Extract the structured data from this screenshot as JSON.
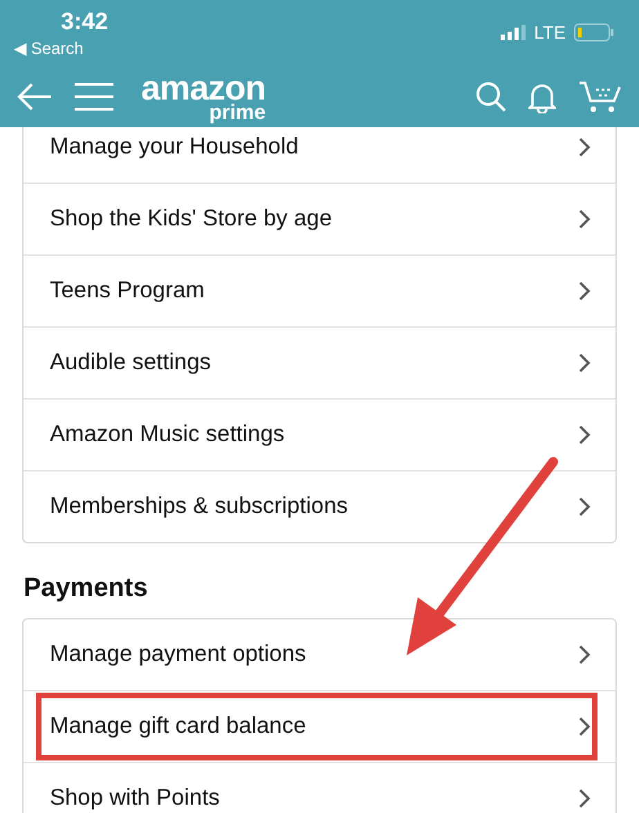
{
  "status_bar": {
    "time": "3:42",
    "back_label": "◀ Search",
    "network": "LTE"
  },
  "nav": {
    "logo_word": "amazon",
    "logo_sub": "prime"
  },
  "sections": [
    {
      "rows": [
        {
          "label": "Manage your Household",
          "highlighted": false
        },
        {
          "label": "Shop the Kids' Store by age",
          "highlighted": false
        },
        {
          "label": "Teens Program",
          "highlighted": false
        },
        {
          "label": "Audible settings",
          "highlighted": false
        },
        {
          "label": "Amazon Music settings",
          "highlighted": false
        },
        {
          "label": "Memberships & subscriptions",
          "highlighted": false
        }
      ]
    },
    {
      "heading": "Payments",
      "rows": [
        {
          "label": "Manage payment options",
          "highlighted": false
        },
        {
          "label": "Manage gift card balance",
          "highlighted": true
        },
        {
          "label": "Shop with Points",
          "highlighted": false
        }
      ]
    }
  ],
  "annotation": {
    "kind": "arrow"
  }
}
